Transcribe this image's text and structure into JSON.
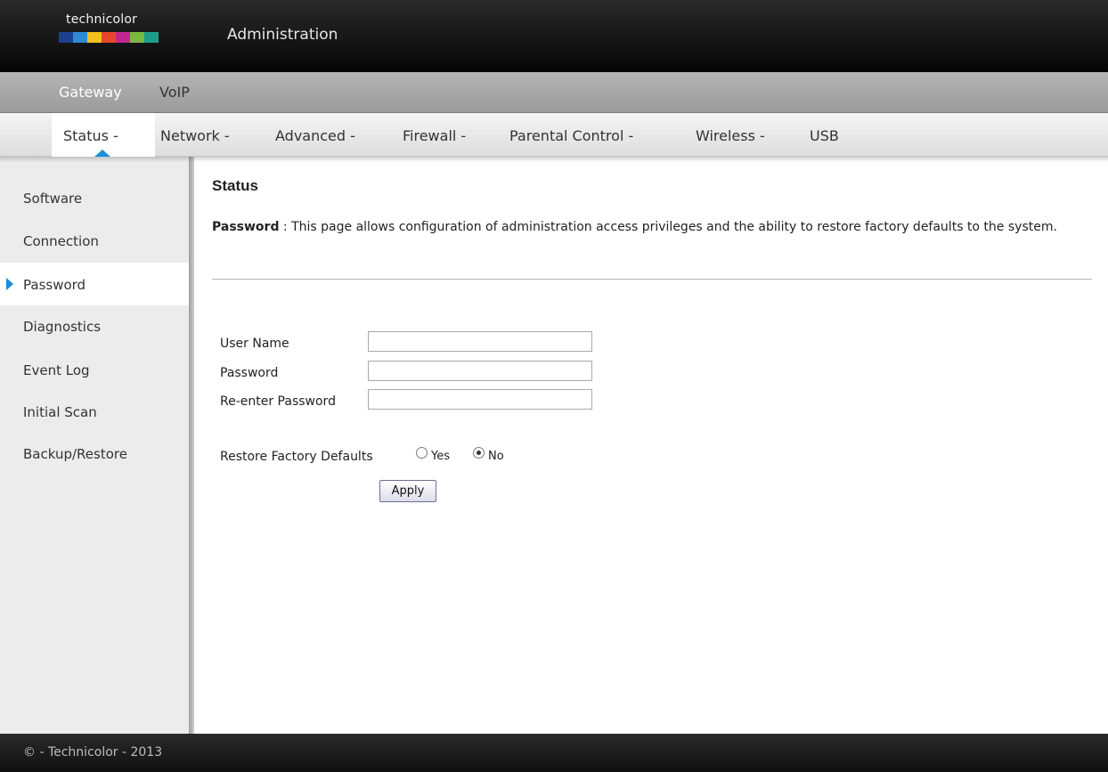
{
  "header": {
    "brand": "technicolor",
    "title": "Administration",
    "logo_colors": [
      "#1c3f8f",
      "#2f8ad8",
      "#f2c21b",
      "#e8472b",
      "#c2278f",
      "#7ab842",
      "#1f9d8c"
    ]
  },
  "topnav": {
    "items": [
      "Gateway",
      "VoIP"
    ]
  },
  "subnav": {
    "items": [
      "Status -",
      "Network -",
      "Advanced -",
      "Firewall -",
      "Parental Control -",
      "Wireless -",
      "USB"
    ],
    "active": "Status -"
  },
  "sidebar": {
    "items": [
      "Software",
      "Connection",
      "Password",
      "Diagnostics",
      "Event Log",
      "Initial Scan",
      "Backup/Restore"
    ],
    "active": "Password"
  },
  "content": {
    "title": "Status",
    "desc_label": "Password",
    "desc_text": " :  This page allows configuration of administration access privileges and the ability to restore factory defaults to the system."
  },
  "form": {
    "user_name_label": "User Name",
    "user_name_value": "",
    "password_label": "Password",
    "password_value": "",
    "reenter_label": "Re-enter Password",
    "reenter_value": "",
    "restore_label": "Restore Factory Defaults",
    "yes_label": "Yes",
    "no_label": "No",
    "restore_selected": "No",
    "apply_label": "Apply"
  },
  "footer": {
    "text": "© - Technicolor - 2013"
  },
  "colors": {
    "accent": "#1b8fd9"
  }
}
